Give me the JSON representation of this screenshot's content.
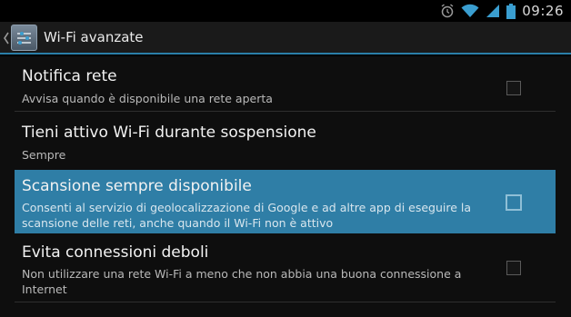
{
  "status_bar": {
    "time": "09:26",
    "icons": [
      "alarm-icon",
      "wifi-icon",
      "signal-icon",
      "battery-icon"
    ]
  },
  "action_bar": {
    "title": "Wi-Fi avanzate",
    "icon": "wifi-settings-icon"
  },
  "settings": [
    {
      "title": "Notifica rete",
      "subtitle": "Avvisa quando è disponibile una rete aperta",
      "checked": false
    },
    {
      "title": "Tieni attivo Wi-Fi durante sospensione",
      "subtitle": "Sempre"
    },
    {
      "title": "Scansione sempre disponibile",
      "subtitle_line1": "Consenti al servizio di geolocalizzazione di Google e ad altre app di eseguire la",
      "subtitle_line2": "scansione delle reti, anche quando il Wi-Fi non è attivo",
      "checked": false,
      "highlighted": true
    },
    {
      "title": "Evita connessioni deboli",
      "subtitle_line1": "Non utilizzare una rete Wi-Fi a meno che non abbia una buona connessione a",
      "subtitle_line2": "Internet",
      "checked": false
    }
  ],
  "colors": {
    "accent": "#2a7fa8",
    "highlight": "#2f7ea6",
    "background": "#0e0e0e"
  }
}
